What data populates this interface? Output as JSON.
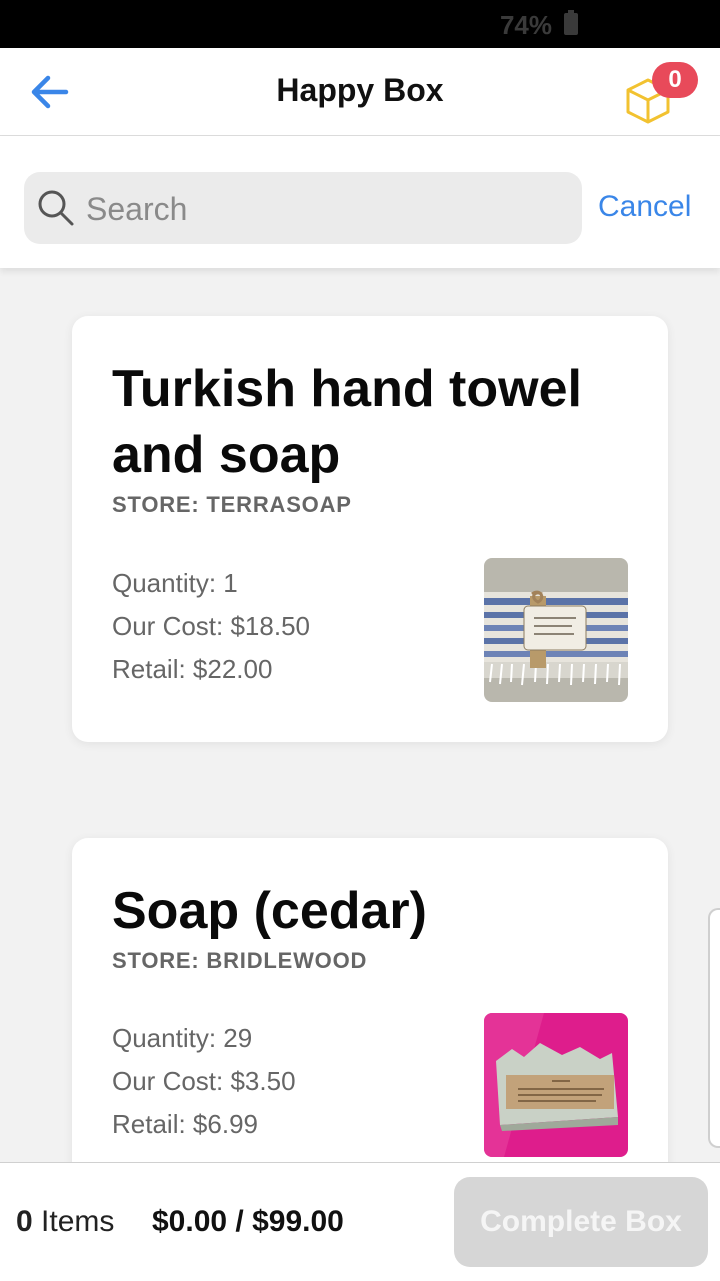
{
  "status_bar": {
    "battery": "74%"
  },
  "header": {
    "title": "Happy Box",
    "cart_count": "0"
  },
  "search": {
    "placeholder": "Search",
    "value": "",
    "cancel_label": "Cancel"
  },
  "products": [
    {
      "title": "Turkish hand towel and soap",
      "store": "STORE: TERRASOAP",
      "quantity": "Quantity: 1",
      "our_cost": "Our Cost: $18.50",
      "retail": "Retail: $22.00"
    },
    {
      "title": "Soap (cedar)",
      "store": "STORE: BRIDLEWOOD",
      "quantity": "Quantity: 29",
      "our_cost": "Our Cost: $3.50",
      "retail": "Retail: $6.99"
    }
  ],
  "footer": {
    "items_count": "0",
    "items_label": " Items",
    "total": "$0.00 / $99.00",
    "complete_label": "Complete Box"
  },
  "colors": {
    "accent": "#3a86e8",
    "badge": "#e84a5a",
    "box_icon": "#f2c230",
    "disabled_button": "#d6d6d6"
  }
}
